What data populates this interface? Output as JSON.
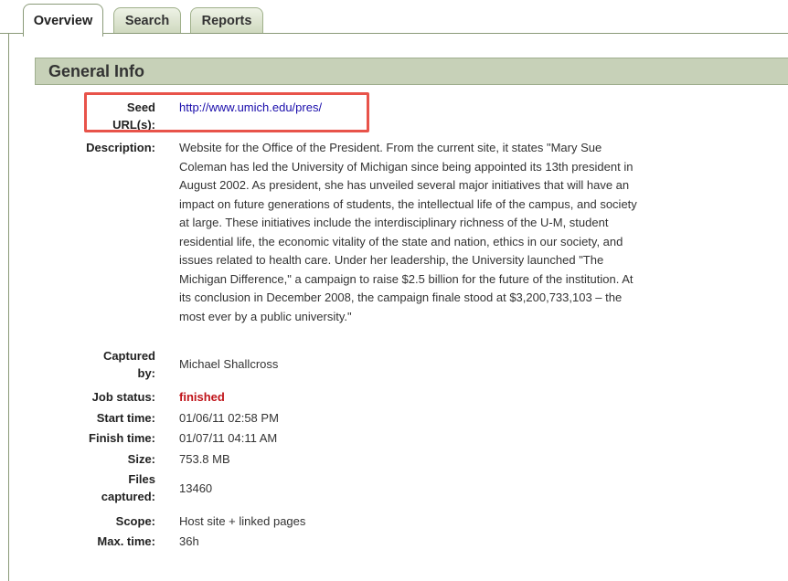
{
  "tabs": [
    {
      "label": "Overview",
      "active": true
    },
    {
      "label": "Search",
      "active": false
    },
    {
      "label": "Reports",
      "active": false
    }
  ],
  "section_title": "General Info",
  "fields": {
    "seed": {
      "label_line1": "Seed",
      "label_line2": "URL(s):",
      "value": "http://www.umich.edu/pres/"
    },
    "description": {
      "label": "Description:",
      "lines": [
        "Website for the Office of the President. From the current site, it states \"Mary Sue",
        "Coleman has led the University of Michigan since being appointed its 13th president in",
        "August 2002. As president, she has unveiled several major initiatives that will have an",
        "impact on future generations of students, the intellectual life of the campus, and society",
        "at large. These initiatives include the interdisciplinary richness of the U-M, student",
        "residential life, the economic vitality of the state and nation, ethics in our society, and",
        "issues related to health care. Under her leadership, the University launched \"The",
        "Michigan Difference,\" a campaign to raise $2.5 billion for the future of the institution. At",
        "its conclusion in December 2008, the campaign finale stood at $3,200,733,103 – the",
        "most ever by a public university.\""
      ]
    },
    "captured_by": {
      "label_line1": "Captured",
      "label_line2": "by:",
      "value": "Michael Shallcross"
    },
    "job_status": {
      "label": "Job status:",
      "value": "finished"
    },
    "start_time": {
      "label": "Start time:",
      "value": "01/06/11 02:58 PM"
    },
    "finish_time": {
      "label": "Finish time:",
      "value": "01/07/11 04:11 AM"
    },
    "size": {
      "label": "Size:",
      "value": "753.8 MB"
    },
    "files_captured": {
      "label_line1": "Files",
      "label_line2": "captured:",
      "value": "13460"
    },
    "scope": {
      "label": "Scope:",
      "value": "Host site + linked pages"
    },
    "max_time": {
      "label": "Max. time:",
      "value": "36h"
    }
  },
  "colors": {
    "status_finished": "#c0141a",
    "link": "#1a0dab",
    "highlight": "#e8534a",
    "header_bg": "#c7d1b8"
  }
}
